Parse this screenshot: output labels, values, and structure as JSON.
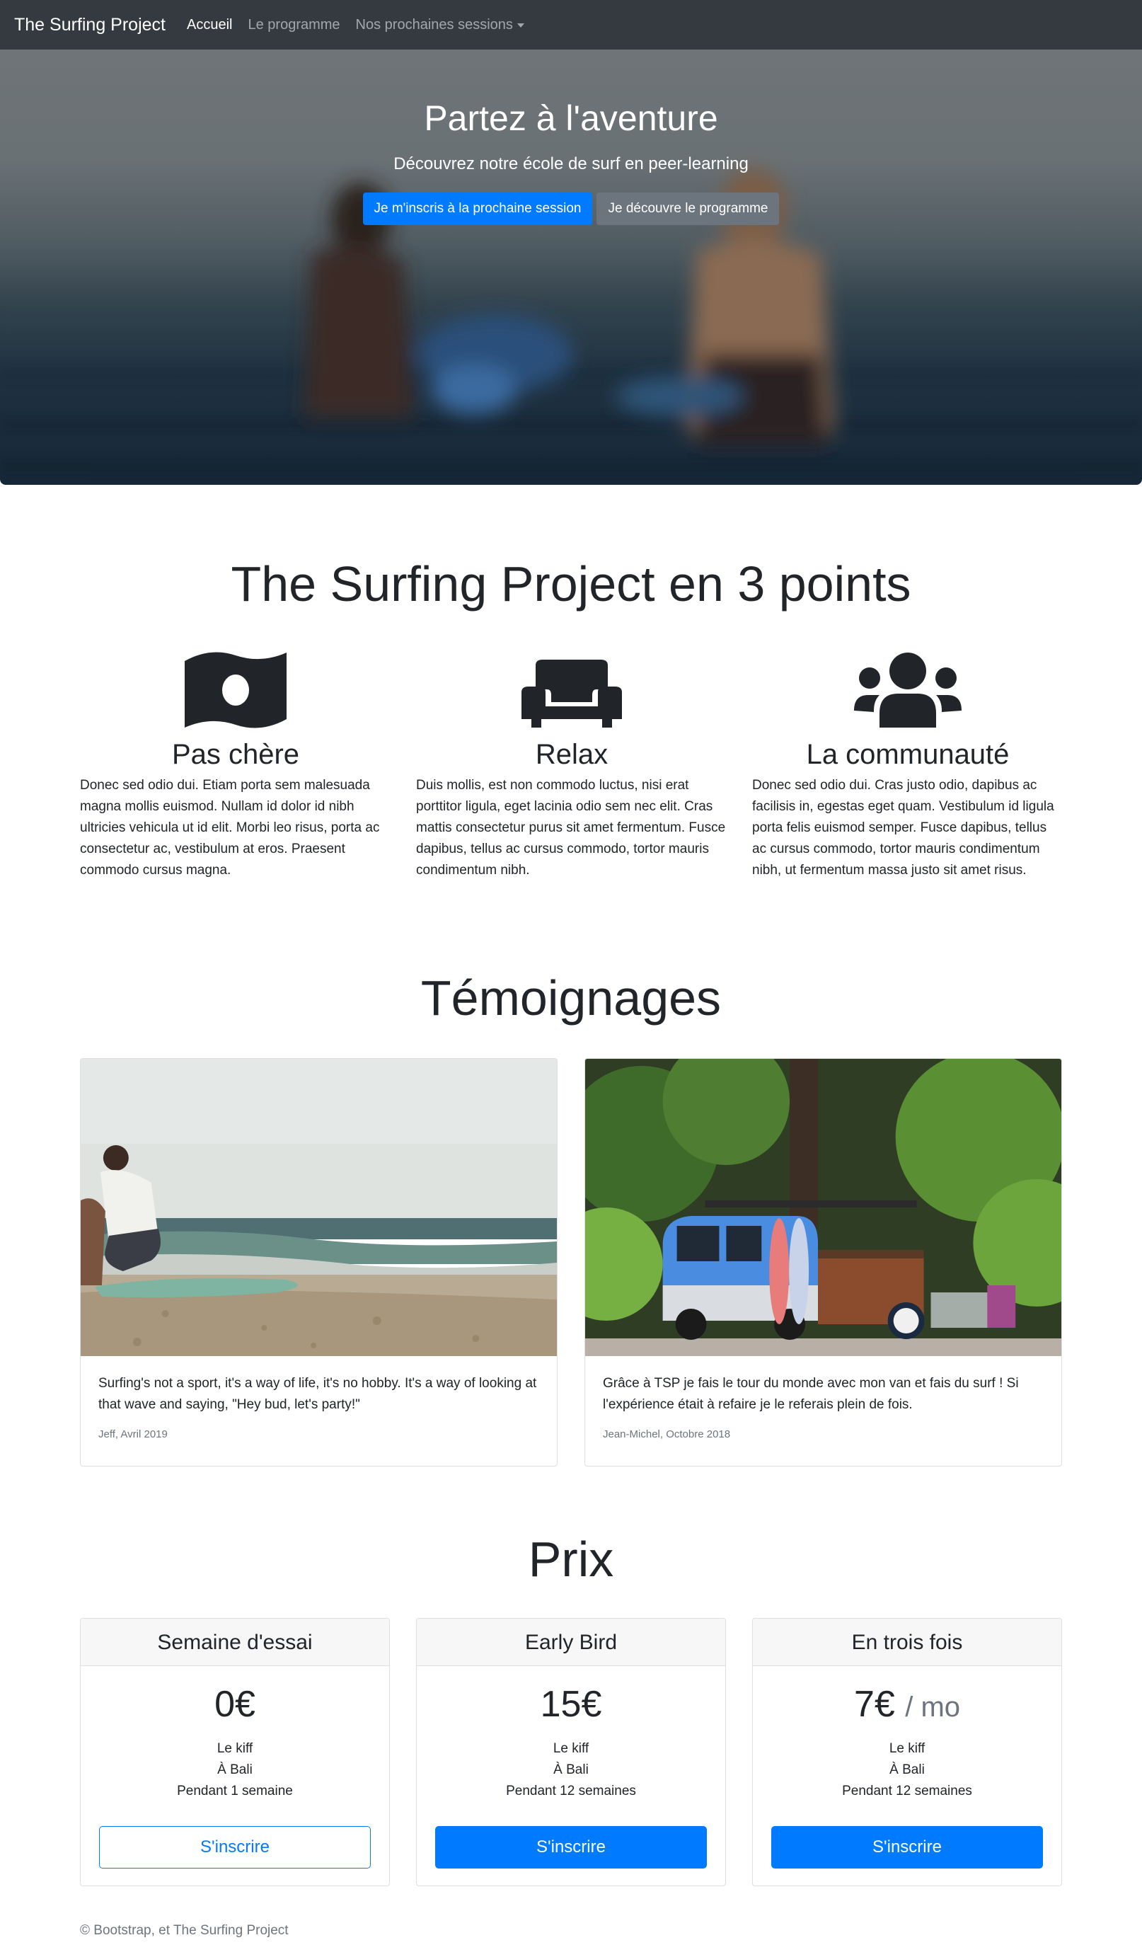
{
  "navbar": {
    "brand": "The Surfing Project",
    "links": [
      {
        "label": "Accueil",
        "active": true
      },
      {
        "label": "Le programme",
        "active": false
      },
      {
        "label": "Nos prochaines sessions",
        "active": false
      }
    ]
  },
  "hero": {
    "title": "Partez à l'aventure",
    "subtitle": "Découvrez notre école de surf en peer-learning",
    "primary_button": "Je m'inscris à la prochaine session",
    "secondary_button": "Je découvre le programme"
  },
  "features": {
    "title": "The Surfing Project en 3 points",
    "items": [
      {
        "icon": "money-bill-icon",
        "title": "Pas chère",
        "text": "Donec sed odio dui. Etiam porta sem malesuada magna mollis euismod. Nullam id dolor id nibh ultricies vehicula ut id elit. Morbi leo risus, porta ac consectetur ac, vestibulum at eros. Praesent commodo cursus magna."
      },
      {
        "icon": "couch-icon",
        "title": "Relax",
        "text": "Duis mollis, est non commodo luctus, nisi erat porttitor ligula, eget lacinia odio sem nec elit. Cras mattis consectetur purus sit amet fermentum. Fusce dapibus, tellus ac cursus commodo, tortor mauris condimentum nibh."
      },
      {
        "icon": "users-icon",
        "title": "La communauté",
        "text": "Donec sed odio dui. Cras justo odio, dapibus ac facilisis in, egestas eget quam. Vestibulum id ligula porta felis euismod semper. Fusce dapibus, tellus ac cursus commodo, tortor mauris condimentum nibh, ut fermentum massa justo sit amet risus."
      }
    ]
  },
  "testimonials": {
    "title": "Témoignages",
    "items": [
      {
        "text": "Surfing's not a sport, it's a way of life, it's no hobby. It's a way of looking at that wave and saying, \"Hey bud, let's party!\"",
        "author": "Jeff, Avril 2019"
      },
      {
        "text": "Grâce à TSP je fais le tour du monde avec mon van et fais du surf ! Si l'expérience était à refaire je le referais plein de fois.",
        "author": "Jean-Michel, Octobre 2018"
      }
    ]
  },
  "pricing": {
    "title": "Prix",
    "plans": [
      {
        "name": "Semaine d'essai",
        "price": "0€",
        "period": "",
        "features": [
          "Le kiff",
          "À Bali",
          "Pendant 1 semaine"
        ],
        "button": "S'inscrire"
      },
      {
        "name": "Early Bird",
        "price": "15€",
        "period": "",
        "features": [
          "Le kiff",
          "À Bali",
          "Pendant 12 semaines"
        ],
        "button": "S'inscrire"
      },
      {
        "name": "En trois fois",
        "price": "7€",
        "period": "/ mo",
        "features": [
          "Le kiff",
          "À Bali",
          "Pendant 12 semaines"
        ],
        "button": "S'inscrire"
      }
    ]
  },
  "footer": {
    "text": "© Bootstrap, et The Surfing Project"
  },
  "colors": {
    "navbar_bg": "#343a40",
    "primary": "#007bff",
    "secondary": "#6c757d"
  }
}
